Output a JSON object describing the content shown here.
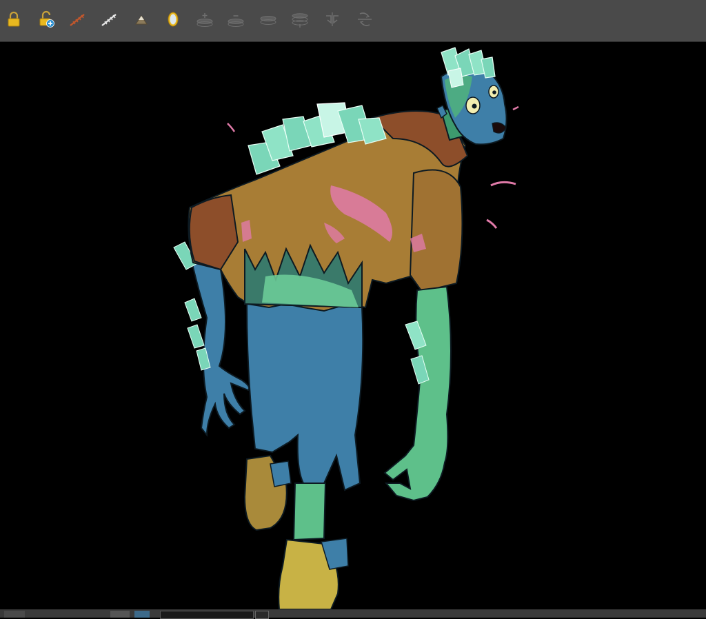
{
  "toolbar": {
    "tools": [
      {
        "name": "lock-icon",
        "enabled": true
      },
      {
        "name": "unlock-add-icon",
        "enabled": true
      },
      {
        "name": "onion-skin-red-icon",
        "enabled": true
      },
      {
        "name": "onion-skin-white-icon",
        "enabled": true
      },
      {
        "name": "peg-icon",
        "enabled": true
      },
      {
        "name": "mirror-icon",
        "enabled": true
      },
      {
        "name": "add-layer-above-icon",
        "enabled": false
      },
      {
        "name": "add-layer-below-icon",
        "enabled": false
      },
      {
        "name": "merge-layer-icon",
        "enabled": false
      },
      {
        "name": "layer-stack-icon",
        "enabled": false
      },
      {
        "name": "flip-horizontal-icon",
        "enabled": false
      },
      {
        "name": "flip-vertical-icon",
        "enabled": false
      }
    ],
    "colors": {
      "bg": "#4a4a4a",
      "lock_gold": "#e8b820",
      "onion_red": "#c2572c",
      "disabled": "#6a6a6a"
    }
  },
  "canvas": {
    "background": "#000000",
    "artwork": "zombie-character-illustration"
  },
  "statusbar": {
    "background": "#3a3a3a"
  }
}
